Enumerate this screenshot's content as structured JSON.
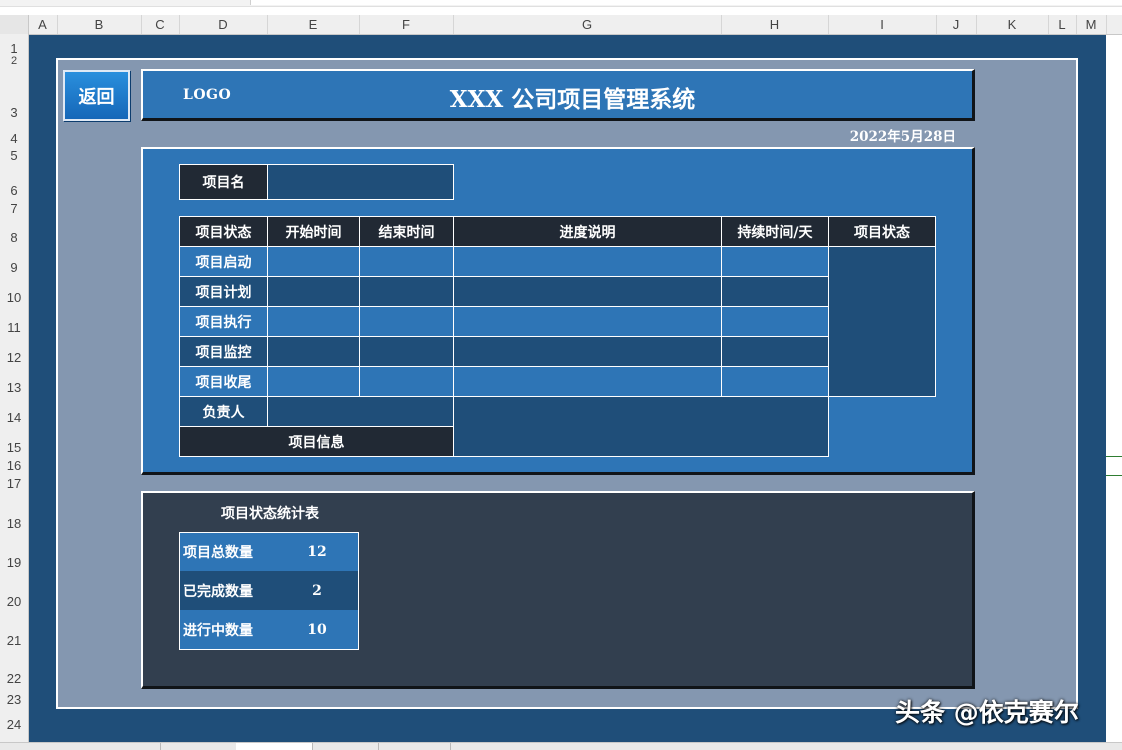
{
  "spreadsheet": {
    "columns": [
      "A",
      "B",
      "C",
      "D",
      "E",
      "F",
      "G",
      "H",
      "I",
      "J",
      "K",
      "L",
      "M"
    ],
    "rows": [
      "1",
      "2",
      "3",
      "4",
      "5",
      "6",
      "7",
      "8",
      "9",
      "10",
      "11",
      "12",
      "13",
      "14",
      "15",
      "16",
      "17",
      "18",
      "19",
      "20",
      "21",
      "22",
      "23",
      "24"
    ]
  },
  "header": {
    "back_label": "返回",
    "logo": "LOGO",
    "title": "XXX 公司项目管理系统",
    "date": "2022年5月28日"
  },
  "project_form": {
    "name_label": "项目名",
    "name_value": "",
    "table_headers": [
      "项目状态",
      "开始时间",
      "结束时间",
      "进度说明",
      "持续时间/天",
      "项目状态"
    ],
    "phases": [
      "项目启动",
      "项目计划",
      "项目执行",
      "项目监控",
      "项目收尾"
    ],
    "owner_label": "负责人",
    "info_label": "项目信息"
  },
  "stats": {
    "title": "项目状态统计表",
    "rows": [
      {
        "label": "项目总数量",
        "value": "12"
      },
      {
        "label": "已完成数量",
        "value": "2"
      },
      {
        "label": "进行中数量",
        "value": "10"
      }
    ]
  },
  "watermark": "头条 @依克赛尔",
  "colors": {
    "canvas": "#1f4e79",
    "frame": "#8497b0",
    "accent_blue": "#2e75b6",
    "header_dark": "#212934",
    "stats_panel": "#323f4f"
  }
}
